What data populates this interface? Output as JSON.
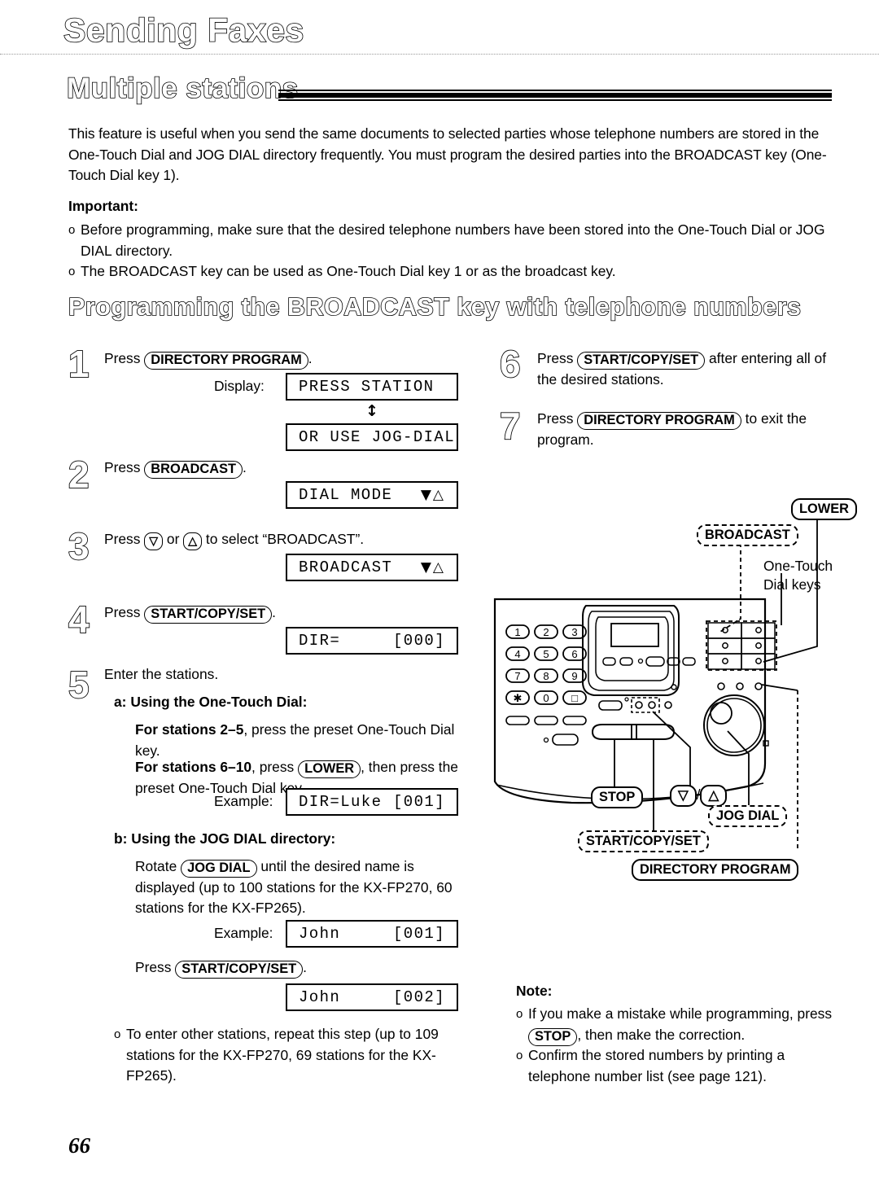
{
  "page": {
    "chapter_title": "Sending Faxes",
    "section_title": "Multiple stations",
    "page_number": "66"
  },
  "intro": {
    "paragraph": "This feature is useful when you send the same documents to selected parties whose telephone numbers are stored in the One-Touch Dial and JOG DIAL directory frequently. You must program the desired parties into the BROADCAST key (One-Touch Dial key 1).",
    "important_label": "Important:",
    "bullets": [
      "Before programming, make sure that the desired telephone numbers have been stored into the One-Touch Dial or JOG DIAL directory.",
      "The BROADCAST key can be used as One-Touch Dial key 1 or as the broadcast key."
    ],
    "bullet_mark": "o"
  },
  "procedure": {
    "heading": "Programming the BROADCAST key with telephone numbers",
    "steps": {
      "s1": {
        "number": "1",
        "press": "Press",
        "key": "DIRECTORY PROGRAM",
        "period": "."
      },
      "s2": {
        "number": "2",
        "press": "Press",
        "key": "BROADCAST",
        "period": "."
      },
      "s3": {
        "number": "3",
        "press": "Press",
        "key_down": "▽",
        "or": "or",
        "key_up": "△",
        "tail": "to select “BROADCAST”."
      },
      "s4": {
        "number": "4",
        "press": "Press",
        "key": "START/COPY/SET",
        "period": "."
      },
      "s5": {
        "number": "5",
        "lead": "Enter the stations.",
        "a_label": "a:",
        "a_title": "Using the One-Touch Dial:",
        "a_line1_bold": "For stations 2–5",
        "a_line1_rest": ", press the preset One-Touch Dial key.",
        "a_line2_bold": "For stations 6–10",
        "a_line2_mid": ", press",
        "a_line2_key": "LOWER",
        "a_line2_rest": ", then press the preset One-Touch Dial key.",
        "b_label": "b:",
        "b_title": "Using the JOG DIAL directory:",
        "b_line_pre": "Rotate",
        "b_line_key": "JOG DIAL",
        "b_line_rest": "until the desired name is displayed (up to 100 stations for the KX-FP270, 60 stations for the KX-FP265).",
        "b_press": "Press",
        "b_press_key": "START/COPY/SET",
        "b_press_period": ".",
        "note_bullet": "To enter other stations, repeat this step (up to 109 stations for the KX-FP270, 69 stations for the KX-FP265)."
      },
      "s6": {
        "number": "6",
        "press": "Press",
        "key": "START/COPY/SET",
        "tail": "after entering all of the desired stations."
      },
      "s7": {
        "number": "7",
        "press": "Press",
        "key": "DIRECTORY PROGRAM",
        "tail": "to exit the program."
      }
    },
    "captions": {
      "display": "Display:",
      "example": "Example:"
    },
    "displays": {
      "d1": {
        "left": "PRESS STATION",
        "right": ""
      },
      "d2": {
        "left": "OR USE JOG-DIAL",
        "right": ""
      },
      "d3": {
        "left": "DIAL MODE",
        "right": "▼△"
      },
      "d4": {
        "left": "BROADCAST",
        "right": "▼△"
      },
      "d5": {
        "left": "DIR=",
        "right": "[000]"
      },
      "d6": {
        "left": "DIR=Luke",
        "right": "[001]"
      },
      "d7": {
        "left": "John",
        "right": "[001]"
      },
      "d8": {
        "left": "John",
        "right": "[002]"
      }
    },
    "toggle_arrow": "↕"
  },
  "diagram": {
    "callouts": {
      "lower": "LOWER",
      "broadcast": "BROADCAST",
      "stop": "STOP",
      "updown": {
        "down": "▽",
        "sep": "/",
        "up": "△"
      },
      "jog_dial": "JOG DIAL",
      "start_copy_set": "START/COPY/SET",
      "directory_program": "DIRECTORY PROGRAM"
    },
    "plain_labels": {
      "one_touch_line1": "One-Touch",
      "one_touch_line2": "Dial keys"
    },
    "keypad": [
      "1",
      "2",
      "3",
      "4",
      "5",
      "6",
      "7",
      "8",
      "9",
      "✱",
      "0",
      "□"
    ]
  },
  "note": {
    "label": "Note:",
    "bullet_mark": "o",
    "bullets": [
      {
        "pre": "If you make a mistake while programming, press",
        "key": "STOP",
        "post": ", then make the correction."
      },
      {
        "pre": "Confirm the stored numbers by printing a telephone number list (see page 121).",
        "key": "",
        "post": ""
      }
    ]
  }
}
